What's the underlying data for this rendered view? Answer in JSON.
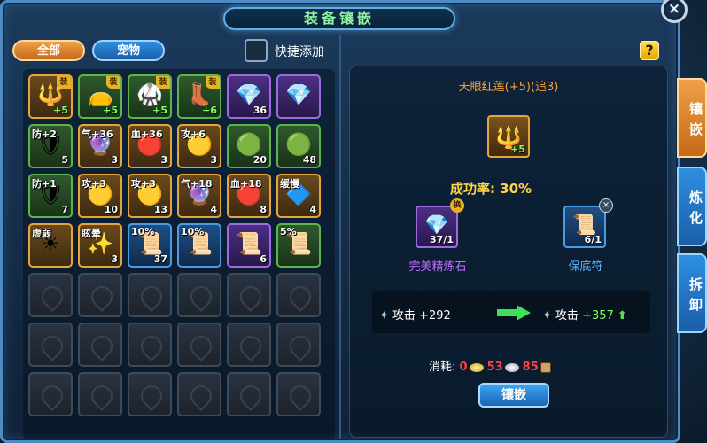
{
  "window": {
    "title": "装备镶嵌",
    "close_label": "×"
  },
  "filters": {
    "all_label": "全部",
    "pet_label": "宠物",
    "quick_add_label": "快捷添加"
  },
  "help_label": "?",
  "grid_items": [
    {
      "icon": "trident",
      "glyph": "🔱",
      "rarity": "orange",
      "top_label": "",
      "count": "",
      "plus": "+5",
      "badge": "装"
    },
    {
      "icon": "pouch",
      "glyph": "👝",
      "rarity": "green",
      "top_label": "",
      "count": "",
      "plus": "+5",
      "badge": "装"
    },
    {
      "icon": "armor",
      "glyph": "🥋",
      "rarity": "green",
      "top_label": "",
      "count": "",
      "plus": "+5",
      "badge": "装"
    },
    {
      "icon": "boots",
      "glyph": "👢",
      "rarity": "green",
      "top_label": "",
      "count": "",
      "plus": "+6",
      "badge": "装"
    },
    {
      "icon": "crystal",
      "glyph": "💎",
      "rarity": "purple",
      "top_label": "",
      "count": "36",
      "plus": "",
      "badge": ""
    },
    {
      "icon": "crystal",
      "glyph": "💎",
      "rarity": "purple",
      "top_label": "",
      "count": "",
      "plus": "",
      "badge": ""
    },
    {
      "icon": "shield-gem",
      "glyph": "🛡",
      "rarity": "green",
      "top_label": "防+2",
      "count": "5",
      "plus": "",
      "badge": ""
    },
    {
      "icon": "orb-gem",
      "glyph": "🔮",
      "rarity": "orange",
      "top_label": "气+36",
      "count": "3",
      "plus": "",
      "badge": ""
    },
    {
      "icon": "blood-gem",
      "glyph": "🔴",
      "rarity": "orange",
      "top_label": "血+36",
      "count": "3",
      "plus": "",
      "badge": ""
    },
    {
      "icon": "attack-gem",
      "glyph": "🟡",
      "rarity": "orange",
      "top_label": "攻+6",
      "count": "3",
      "plus": "",
      "badge": ""
    },
    {
      "icon": "jade",
      "glyph": "🟢",
      "rarity": "green",
      "top_label": "",
      "count": "20",
      "plus": "",
      "badge": ""
    },
    {
      "icon": "jade",
      "glyph": "🟢",
      "rarity": "green",
      "top_label": "",
      "count": "48",
      "plus": "",
      "badge": ""
    },
    {
      "icon": "shield-gem",
      "glyph": "🛡",
      "rarity": "green",
      "top_label": "防+1",
      "count": "7",
      "plus": "",
      "badge": ""
    },
    {
      "icon": "attack-gem",
      "glyph": "🟡",
      "rarity": "orange",
      "top_label": "攻+3",
      "count": "10",
      "plus": "",
      "badge": ""
    },
    {
      "icon": "attack-gem",
      "glyph": "🟡",
      "rarity": "orange",
      "top_label": "攻+3",
      "count": "13",
      "plus": "",
      "badge": ""
    },
    {
      "icon": "orb-gem",
      "glyph": "🔮",
      "rarity": "orange",
      "top_label": "气+18",
      "count": "4",
      "plus": "",
      "badge": ""
    },
    {
      "icon": "blood-gem",
      "glyph": "🔴",
      "rarity": "orange",
      "top_label": "血+18",
      "count": "8",
      "plus": "",
      "badge": ""
    },
    {
      "icon": "slow-gem",
      "glyph": "🔷",
      "rarity": "orange",
      "top_label": "缓慢",
      "count": "4",
      "plus": "",
      "badge": ""
    },
    {
      "icon": "weak-gem",
      "glyph": "☀",
      "rarity": "orange",
      "top_label": "虚弱",
      "count": "",
      "plus": "",
      "badge": ""
    },
    {
      "icon": "dizzy-gem",
      "glyph": "✨",
      "rarity": "orange",
      "top_label": "眩晕",
      "count": "3",
      "plus": "",
      "badge": ""
    },
    {
      "icon": "talisman",
      "glyph": "📜",
      "rarity": "blue",
      "top_label": "10%",
      "count": "37",
      "plus": "",
      "badge": ""
    },
    {
      "icon": "talisman",
      "glyph": "📜",
      "rarity": "blue",
      "top_label": "10%",
      "count": "",
      "plus": "",
      "badge": ""
    },
    {
      "icon": "talisman",
      "glyph": "📜",
      "rarity": "purple",
      "top_label": "",
      "count": "6",
      "plus": "",
      "badge": ""
    },
    {
      "icon": "talisman",
      "glyph": "📜",
      "rarity": "green",
      "top_label": "5%",
      "count": "",
      "plus": "",
      "badge": ""
    }
  ],
  "empty_slot_count": 18,
  "detail": {
    "equip_name": "天眼红莲(+5)(追3)",
    "equip_icon": "trident",
    "equip_glyph": "🔱",
    "equip_plus": "+5",
    "success_rate": "成功率: 30%",
    "material_stone": {
      "name": "完美精炼石",
      "count": "37/1",
      "glyph": "💎",
      "badge": "换"
    },
    "material_charm": {
      "name": "保底符",
      "count": "6/1",
      "glyph": "📜",
      "remove": "×"
    },
    "stat_label": "攻击",
    "stat_before": "+292",
    "stat_after": "+357",
    "cost_label": "消耗:",
    "cost_gold_zero": "0",
    "cost_gold": "53",
    "cost_silver": "85",
    "inlay_button": "镶嵌"
  },
  "side_tabs": {
    "inlay": "镶嵌",
    "refine": "炼化",
    "dismantle": "拆卸"
  },
  "colors": {
    "accent": "#5fb0e6",
    "orange": "#e5a53c",
    "green_text": "#7dff5a",
    "red_text": "#ff4040"
  }
}
